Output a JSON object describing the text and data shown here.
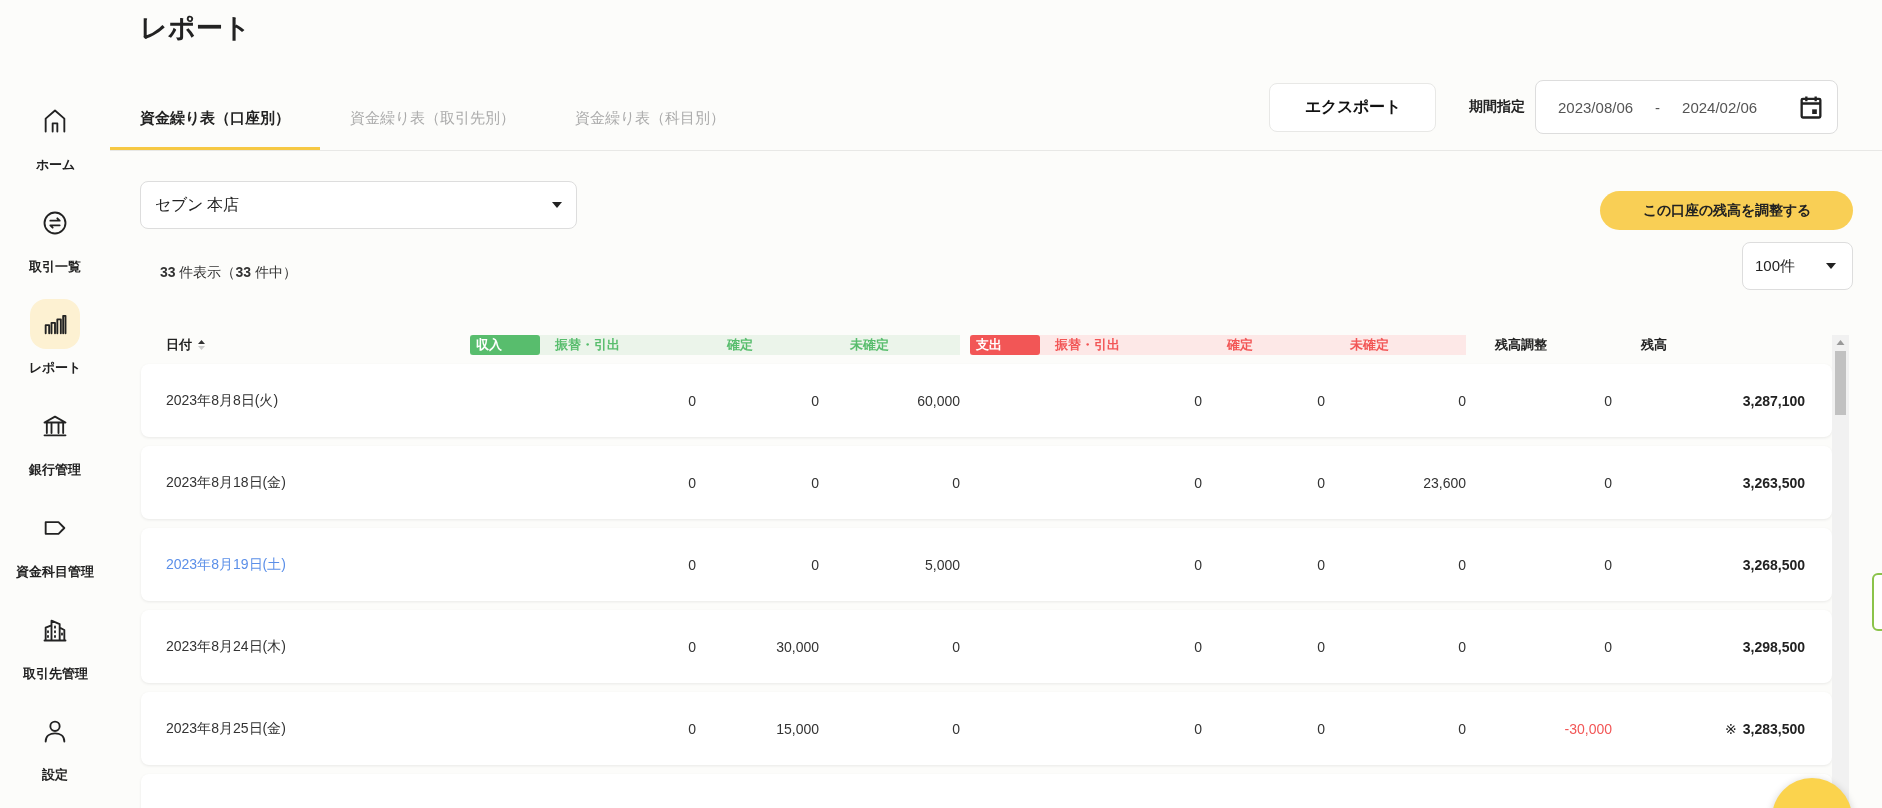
{
  "page_title": "レポート",
  "sidebar": {
    "items": [
      {
        "label": "ホーム",
        "kind": "home",
        "selected": false
      },
      {
        "label": "取引一覧",
        "kind": "transactions",
        "selected": false
      },
      {
        "label": "レポート",
        "kind": "report",
        "selected": true
      },
      {
        "label": "銀行管理",
        "kind": "bank",
        "selected": false
      },
      {
        "label": "資金科目管理",
        "kind": "category",
        "selected": false
      },
      {
        "label": "取引先管理",
        "kind": "partner",
        "selected": false
      },
      {
        "label": "設定",
        "kind": "settings",
        "selected": false
      }
    ]
  },
  "tabs": [
    {
      "label": "資金繰り表（口座別）",
      "selected": true
    },
    {
      "label": "資金繰り表（取引先別）",
      "selected": false
    },
    {
      "label": "資金繰り表（科目別）",
      "selected": false
    }
  ],
  "export_button": "エクスポート",
  "period": {
    "label": "期間指定",
    "start": "2023/08/06",
    "separator": "-",
    "end": "2024/02/06"
  },
  "account_select": {
    "value": "セブン 本店"
  },
  "adjust_button": "この口座の残高を調整する",
  "count": {
    "shown": "33",
    "shown_suffix": "件表示（",
    "total": "33",
    "total_suffix": "件中）"
  },
  "page_size_select": {
    "value": "100件"
  },
  "table": {
    "date_header": "日付",
    "income": {
      "badge": "収入",
      "columns": [
        "振替・引出",
        "確定",
        "未確定"
      ]
    },
    "expense": {
      "badge": "支出",
      "columns": [
        "振替・引出",
        "確定",
        "未確定"
      ]
    },
    "adjust_header": "残高調整",
    "balance_header": "残高",
    "rows": [
      {
        "date": "2023年8月8日(火)",
        "saturday": false,
        "values": [
          "0",
          "0",
          "60,000",
          "0",
          "0",
          "0"
        ],
        "adjustment": "0",
        "adjustment_negative": false,
        "mark": null,
        "balance": "3,287,100"
      },
      {
        "date": "2023年8月18日(金)",
        "saturday": false,
        "values": [
          "0",
          "0",
          "0",
          "0",
          "0",
          "23,600"
        ],
        "adjustment": "0",
        "adjustment_negative": false,
        "mark": null,
        "balance": "3,263,500"
      },
      {
        "date": "2023年8月19日(土)",
        "saturday": true,
        "values": [
          "0",
          "0",
          "5,000",
          "0",
          "0",
          "0"
        ],
        "adjustment": "0",
        "adjustment_negative": false,
        "mark": null,
        "balance": "3,268,500"
      },
      {
        "date": "2023年8月24日(木)",
        "saturday": false,
        "values": [
          "0",
          "30,000",
          "0",
          "0",
          "0",
          "0"
        ],
        "adjustment": "0",
        "adjustment_negative": false,
        "mark": null,
        "balance": "3,298,500"
      },
      {
        "date": "2023年8月25日(金)",
        "saturday": false,
        "values": [
          "0",
          "15,000",
          "0",
          "0",
          "0",
          "0"
        ],
        "adjustment": "-30,000",
        "adjustment_negative": true,
        "mark": "※",
        "balance": "3,283,500"
      }
    ]
  }
}
